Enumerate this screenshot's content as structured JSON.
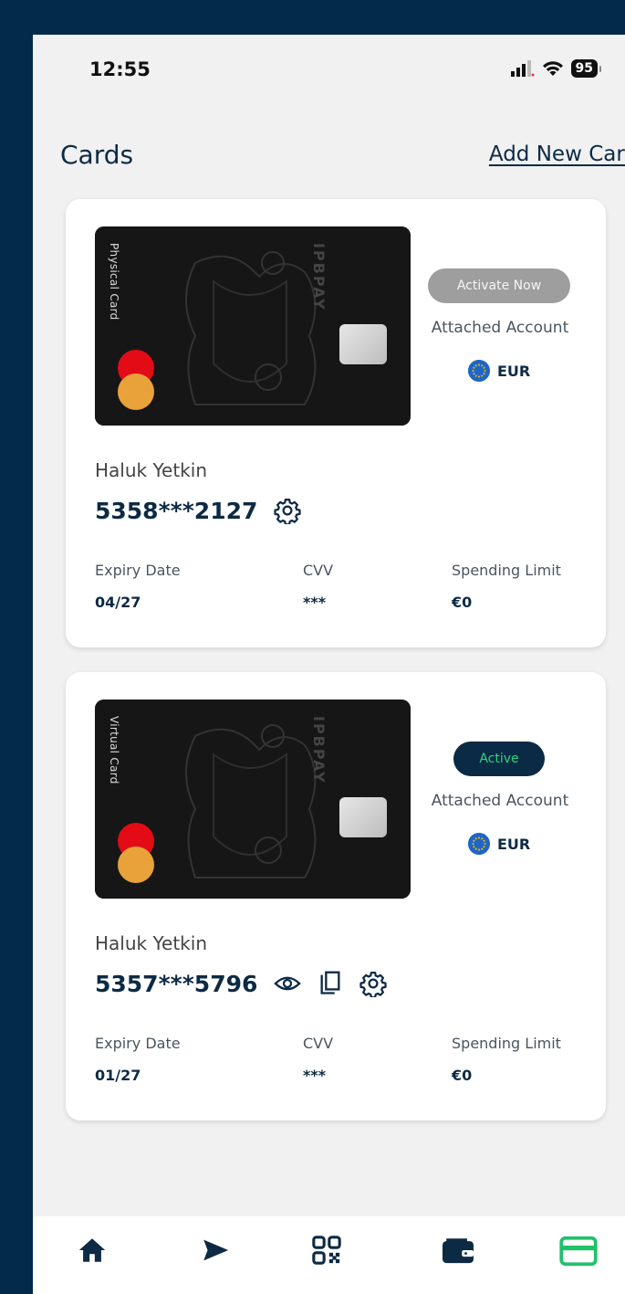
{
  "status_bar": {
    "time": "12:55",
    "battery": "95"
  },
  "header": {
    "title": "Cards",
    "add_link": "Add New Card"
  },
  "cards": [
    {
      "type_label": "Physical Card",
      "brand": "IPBPAY",
      "status": "Activate Now",
      "attached_label": "Attached Account",
      "currency": "EUR",
      "holder": "Haluk Yetkin",
      "number": "5358***2127",
      "expiry_label": "Expiry Date",
      "expiry": "04/27",
      "cvv_label": "CVV",
      "cvv": "***",
      "limit_label": "Spending Limit",
      "limit": "€0"
    },
    {
      "type_label": "Virtual Card",
      "brand": "IPBPAY",
      "status": "Active",
      "attached_label": "Attached Account",
      "currency": "EUR",
      "holder": "Haluk Yetkin",
      "number": "5357***5796",
      "expiry_label": "Expiry Date",
      "expiry": "01/27",
      "cvv_label": "CVV",
      "cvv": "***",
      "limit_label": "Spending Limit",
      "limit": "€0"
    }
  ],
  "nav": {
    "items": [
      "home-icon",
      "send-icon",
      "qr-code-icon",
      "wallet-icon",
      "card-icon"
    ],
    "active_color": "#21c16b",
    "color": "#0d2a45"
  }
}
